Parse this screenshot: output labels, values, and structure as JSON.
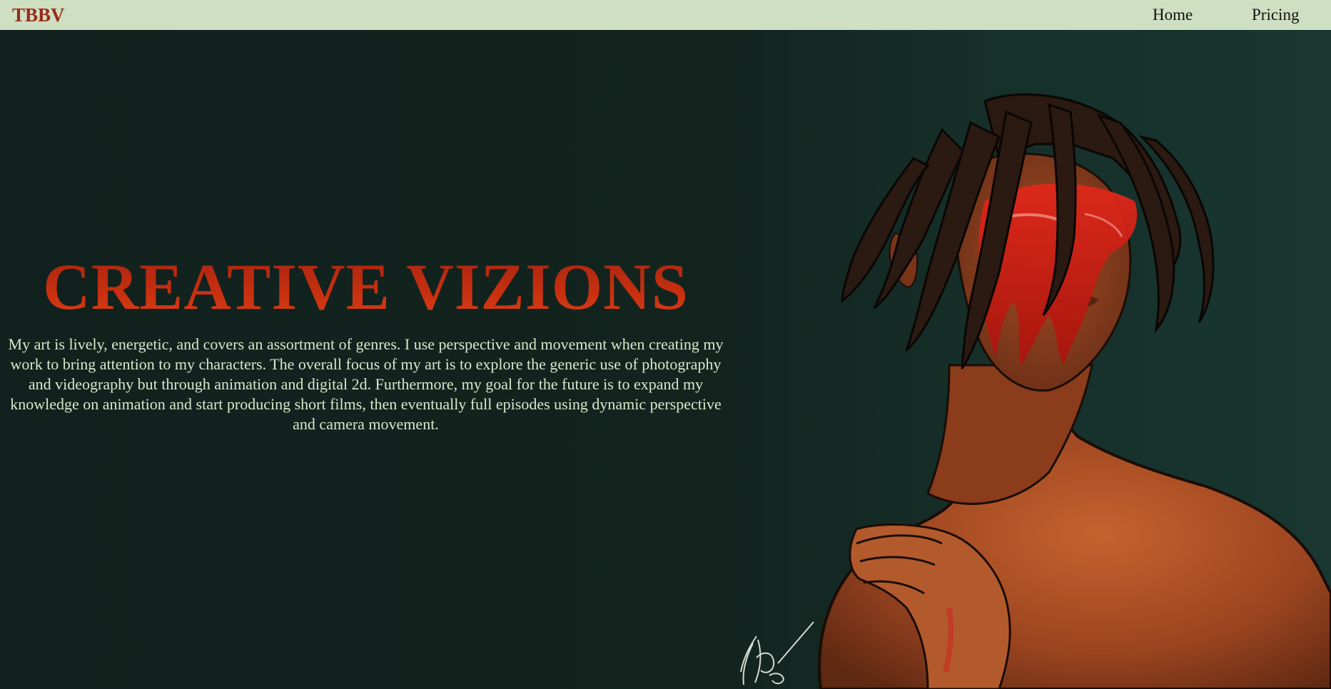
{
  "nav": {
    "brand": "TBBV",
    "links": [
      "Home",
      "Pricing"
    ]
  },
  "hero": {
    "title": "CREATIVE VIZIONS",
    "description": "My art is lively, energetic, and covers an assortment of genres. I use perspective and movement when creating my work to bring attention to my characters. The overall focus of my art is to explore the generic use of photography and videography but through animation and digital 2d. Furthermore, my goal for the future is to expand my knowledge on animation and start producing short films, then eventually full episodes using dynamic perspective and camera movement.",
    "artwork": {
      "subject": "digital painting portrait with dreadlocks and red paint over the eyes",
      "signature": "TBBV"
    }
  },
  "colors": {
    "navbar_bg": "#cfdfc2",
    "brand": "#9a2a18",
    "page_bg": "#13241f",
    "title_red": "#c8300f",
    "body_text": "#d7e8cc"
  }
}
